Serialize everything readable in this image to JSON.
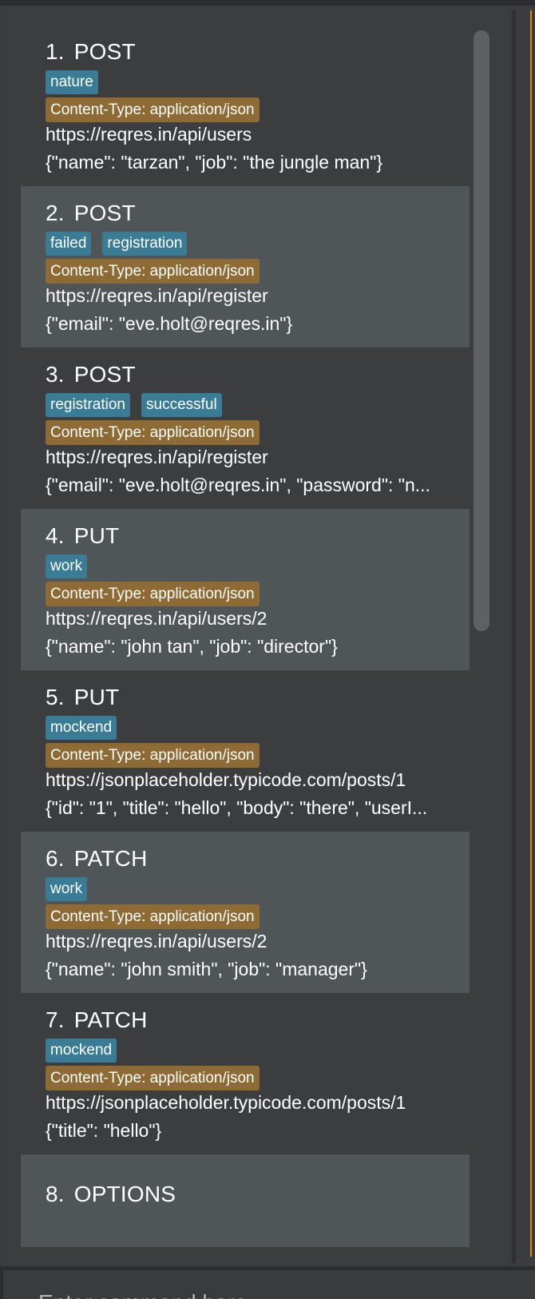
{
  "requests": [
    {
      "index": "1.",
      "method": "POST",
      "tags": [
        "nature"
      ],
      "header": "Content-Type: application/json",
      "url": "https://reqres.in/api/users",
      "body": "{\"name\": \"tarzan\", \"job\": \"the jungle man\"}"
    },
    {
      "index": "2.",
      "method": "POST",
      "tags": [
        "failed",
        "registration"
      ],
      "header": "Content-Type: application/json",
      "url": "https://reqres.in/api/register",
      "body": "{\"email\": \"eve.holt@reqres.in\"}"
    },
    {
      "index": "3.",
      "method": "POST",
      "tags": [
        "registration",
        "successful"
      ],
      "header": "Content-Type: application/json",
      "url": "https://reqres.in/api/register",
      "body": "{\"email\": \"eve.holt@reqres.in\", \"password\": \"n..."
    },
    {
      "index": "4.",
      "method": "PUT",
      "tags": [
        "work"
      ],
      "header": "Content-Type: application/json",
      "url": "https://reqres.in/api/users/2",
      "body": "{\"name\": \"john tan\", \"job\": \"director\"}"
    },
    {
      "index": "5.",
      "method": "PUT",
      "tags": [
        "mockend"
      ],
      "header": "Content-Type: application/json",
      "url": "https://jsonplaceholder.typicode.com/posts/1",
      "body": "{\"id\": \"1\", \"title\": \"hello\", \"body\": \"there\", \"userI..."
    },
    {
      "index": "6.",
      "method": "PATCH",
      "tags": [
        "work"
      ],
      "header": "Content-Type: application/json",
      "url": "https://reqres.in/api/users/2",
      "body": "{\"name\": \"john smith\", \"job\": \"manager\"}"
    },
    {
      "index": "7.",
      "method": "PATCH",
      "tags": [
        "mockend"
      ],
      "header": "Content-Type: application/json",
      "url": "https://jsonplaceholder.typicode.com/posts/1",
      "body": "{\"title\": \"hello\"}"
    },
    {
      "index": "8.",
      "method": "OPTIONS",
      "tags": [],
      "header": "",
      "url": "",
      "body": ""
    }
  ],
  "command_box": {
    "placeholder": "Enter command here..."
  },
  "colors": {
    "tag_blue": "#3a7b95",
    "header_tag_brown": "#8e6b35",
    "card_dark": "#3c3d3f",
    "card_light": "#505558",
    "right_panel_border": "#d9861f"
  }
}
